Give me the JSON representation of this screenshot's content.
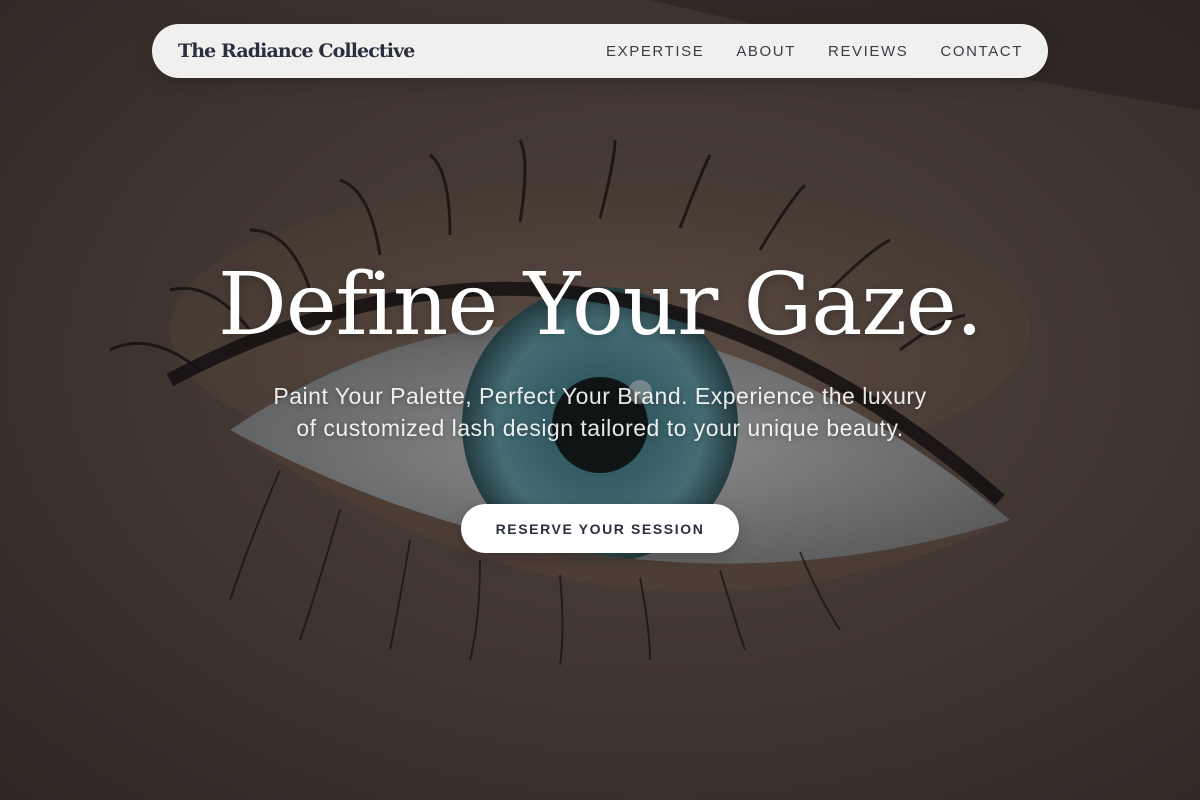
{
  "nav": {
    "brand": "The Radiance Collective",
    "links": [
      {
        "label": "EXPERTISE"
      },
      {
        "label": "ABOUT"
      },
      {
        "label": "REVIEWS"
      },
      {
        "label": "CONTACT"
      }
    ]
  },
  "hero": {
    "title": "Define Your Gaze.",
    "subtitle": "Paint Your Palette, Perfect Your Brand. Experience the luxury of customized lash design tailored to your unique beauty.",
    "cta_label": "RESERVE YOUR SESSION",
    "background_image": "close-up-eye-photo"
  },
  "colors": {
    "nav_bg": "#f1f0ef",
    "brand_text": "#2b2f3d",
    "hero_text": "#ffffff",
    "button_bg": "#ffffff",
    "iris": "#3f7c88"
  }
}
